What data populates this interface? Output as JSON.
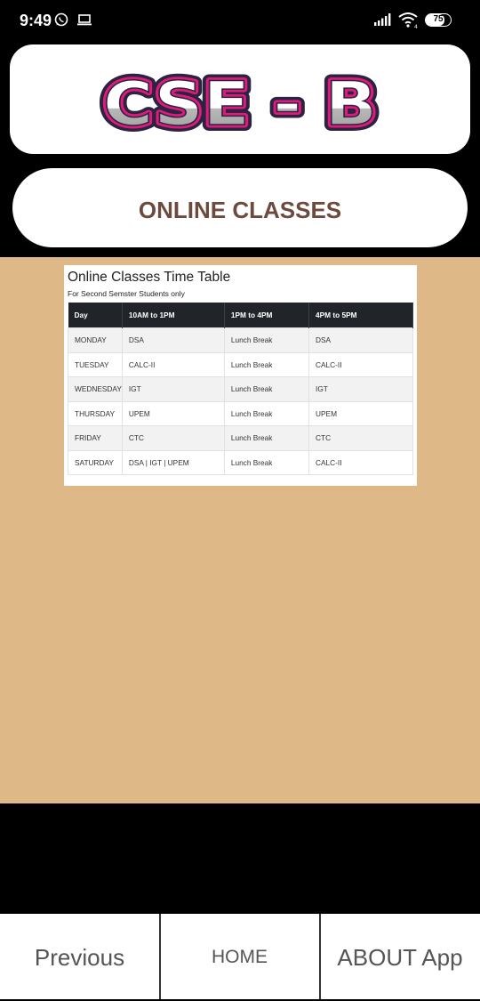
{
  "status_bar": {
    "time": "9:49",
    "icons": [
      "whatsapp-icon",
      "laptop-icon",
      "signal-icon",
      "wifi-icon",
      "battery-icon"
    ],
    "battery_level": "75"
  },
  "header": {
    "logo_text": "CSE - B",
    "logo_colors": {
      "outline": "#e0197a",
      "fill_top": "#ffffff",
      "fill_bottom": "#b8b8b8",
      "shadow": "#2a2440"
    },
    "online_classes_label": "ONLINE CLASSES"
  },
  "timetable": {
    "title": "Online Classes Time Table",
    "subtitle": "For Second Semster Students only",
    "columns": [
      "Day",
      "10AM to 1PM",
      "1PM to 4PM",
      "4PM to 5PM"
    ],
    "rows": [
      [
        "MONDAY",
        "DSA",
        "Lunch Break",
        "DSA"
      ],
      [
        "TUESDAY",
        "CALC-II",
        "Lunch Break",
        "CALC-II"
      ],
      [
        "WEDNESDAY",
        "IGT",
        "Lunch Break",
        "IGT"
      ],
      [
        "THURSDAY",
        "UPEM",
        "Lunch Break",
        "UPEM"
      ],
      [
        "FRIDAY",
        "CTC",
        "Lunch Break",
        "CTC"
      ],
      [
        "SATURDAY",
        "DSA | IGT | UPEM",
        "Lunch Break",
        "CALC-II"
      ]
    ]
  },
  "bottom_nav": {
    "previous_label": "Previous",
    "home_label": "HOME",
    "about_label": "ABOUT App"
  },
  "colors": {
    "content_background": "#dfb887",
    "online_classes_text": "#6e4a3e",
    "table_header": "#212529"
  }
}
